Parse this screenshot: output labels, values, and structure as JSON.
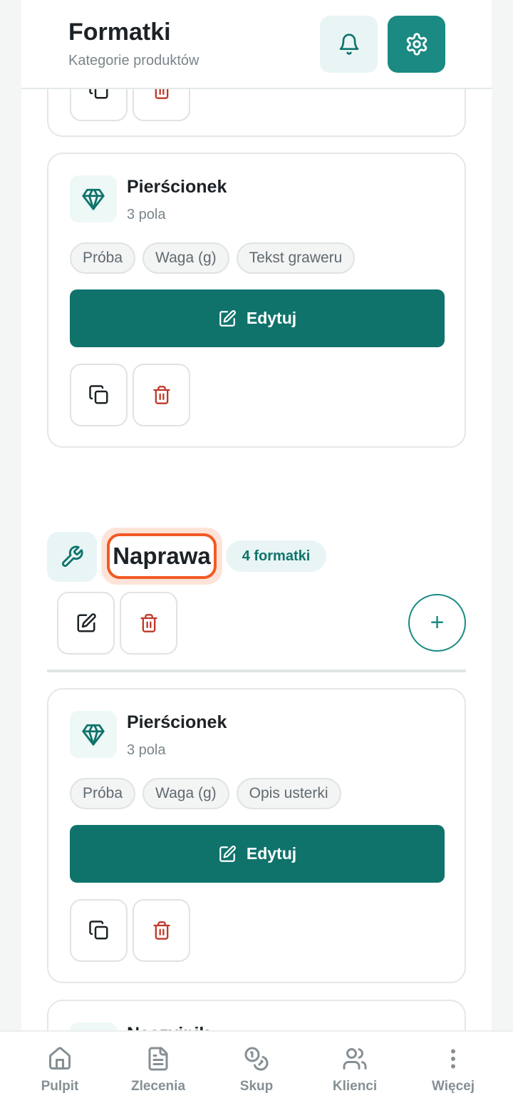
{
  "header": {
    "title": "Formatki",
    "subtitle": "Kategorie produktów"
  },
  "cards_top": [
    {
      "title": "Pierścionek",
      "fields_count": "3 pola",
      "chips": [
        "Próba",
        "Waga (g)",
        "Tekst graweru"
      ],
      "edit_label": "Edytuj"
    }
  ],
  "category": {
    "name": "Naprawa",
    "badge": "4 formatki"
  },
  "cards_category": [
    {
      "title": "Pierścionek",
      "fields_count": "3 pola",
      "chips": [
        "Próba",
        "Waga (g)",
        "Opis usterki"
      ],
      "edit_label": "Edytuj"
    },
    {
      "title": "Naszyjnik"
    }
  ],
  "add_symbol": "+",
  "nav": [
    {
      "label": "Pulpit",
      "icon": "home-icon"
    },
    {
      "label": "Zlecenia",
      "icon": "document-icon"
    },
    {
      "label": "Skup",
      "icon": "coins-icon"
    },
    {
      "label": "Klienci",
      "icon": "users-icon"
    },
    {
      "label": "Więcej",
      "icon": "more-vertical-icon"
    }
  ],
  "colors": {
    "primary": "#0f736c",
    "accent_light": "#e8f5f4",
    "danger": "#c0392b",
    "highlight": "#f15a24"
  }
}
